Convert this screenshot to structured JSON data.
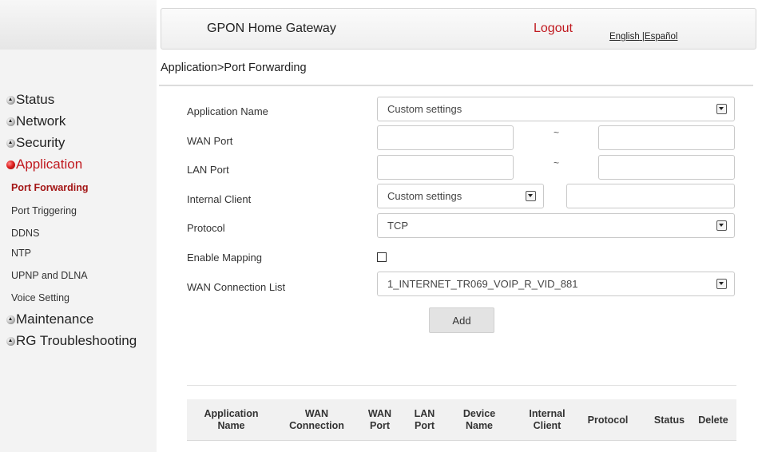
{
  "header": {
    "title": "GPON Home Gateway",
    "logout": "Logout",
    "lang_english": "English",
    "lang_separator": " |",
    "lang_spanish": "Español"
  },
  "breadcrumb": "Application>Port Forwarding",
  "sidebar": {
    "status": "Status",
    "network": "Network",
    "security": "Security",
    "application": "Application",
    "application_items": [
      "Port Forwarding",
      "Port Triggering",
      "DDNS",
      "NTP",
      "UPNP and DLNA",
      "Voice Setting"
    ],
    "maintenance": "Maintenance",
    "rg_troubleshooting": "RG Troubleshooting"
  },
  "form": {
    "application_name_label": "Application Name",
    "application_name_value": "Custom settings",
    "wan_port_label": "WAN Port",
    "wan_port_from": "",
    "wan_port_to": "",
    "lan_port_label": "LAN Port",
    "lan_port_from": "",
    "lan_port_to": "",
    "range_separator": "~",
    "internal_client_label": "Internal Client",
    "internal_client_value": "Custom settings",
    "internal_client_ip": "",
    "protocol_label": "Protocol",
    "protocol_value": "TCP",
    "enable_mapping_label": "Enable Mapping",
    "enable_mapping_checked": false,
    "wan_connection_label": "WAN Connection List",
    "wan_connection_value": "1_INTERNET_TR069_VOIP_R_VID_881",
    "add_button": "Add"
  },
  "table": {
    "headers": [
      [
        "Application",
        "Name"
      ],
      [
        "WAN",
        "Connection"
      ],
      [
        "WAN",
        "Port"
      ],
      [
        "LAN",
        "Port"
      ],
      [
        "Device",
        "Name"
      ],
      [
        "Internal",
        "Client"
      ],
      [
        "Protocol"
      ],
      [
        "Status"
      ],
      [
        "Delete"
      ]
    ]
  },
  "colors": {
    "accent_red": "#c0191f",
    "active_submenu": "#a31515",
    "sidebar_bg": "#f3f3f3",
    "table_header_bg": "#f1f1f1"
  },
  "icons": {
    "menu_bullet": "expand-bullet-icon",
    "active_bullet": "active-bullet-icon",
    "select_arrow": "chevron-down-icon"
  }
}
